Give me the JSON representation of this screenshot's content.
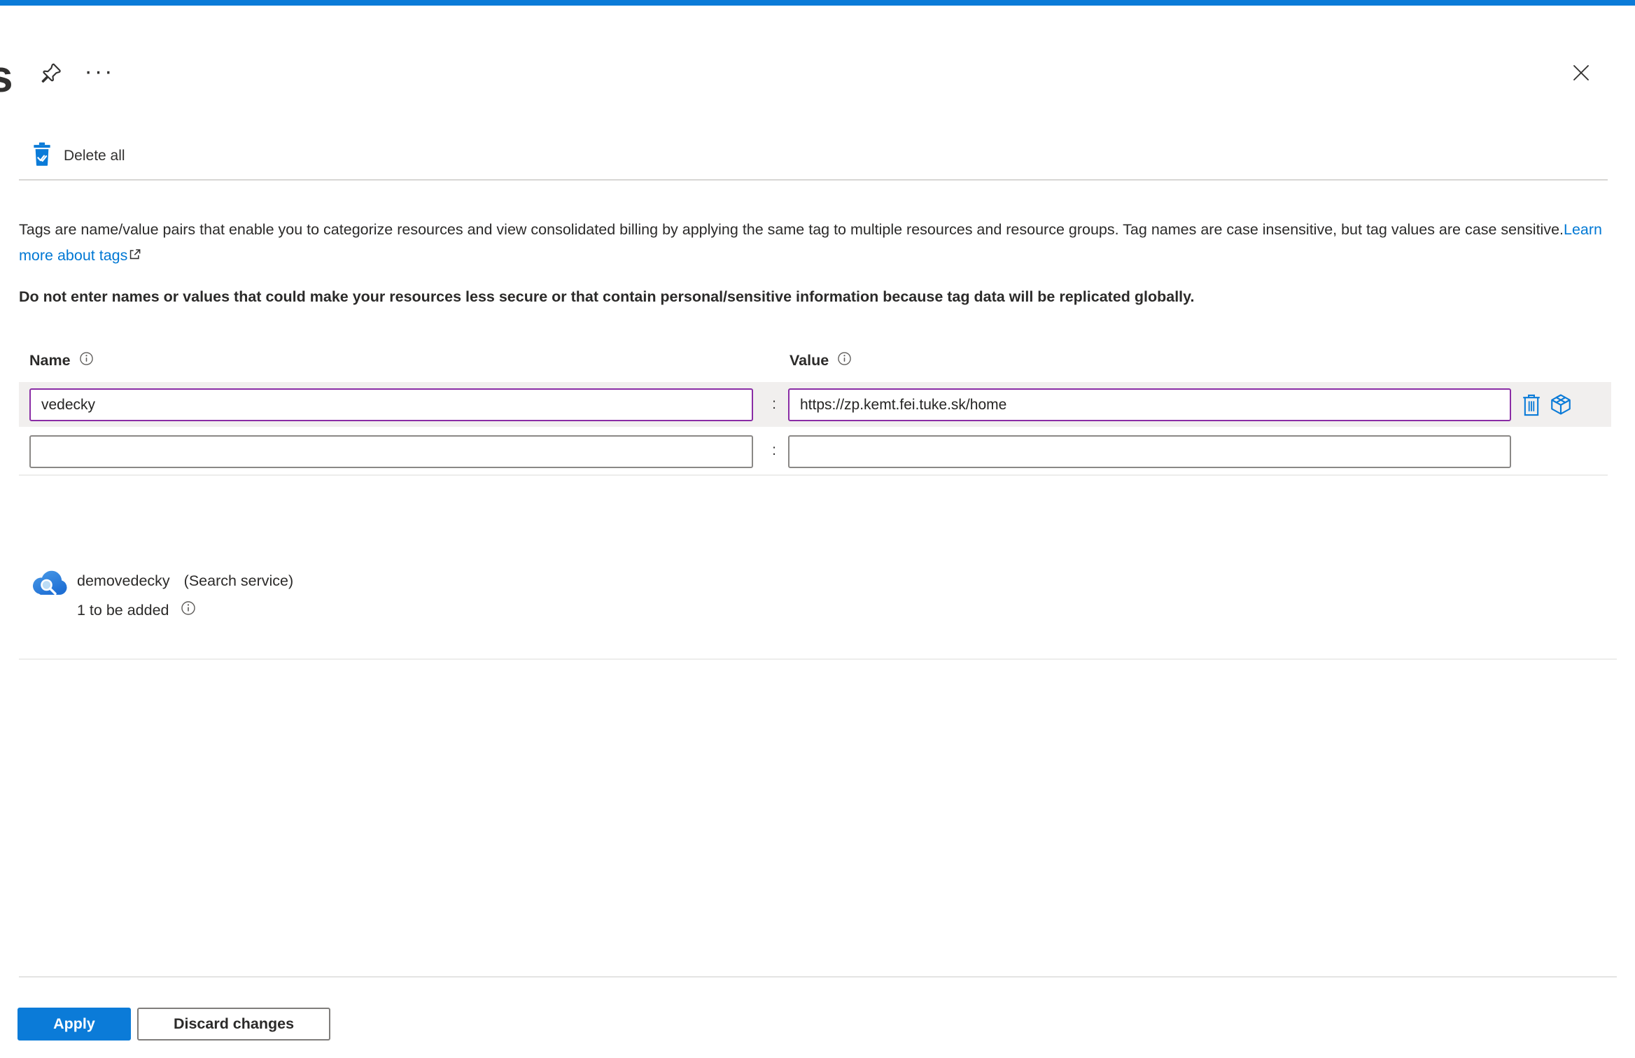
{
  "page": {
    "title_partial": "s"
  },
  "header": {
    "more_glyph": "···"
  },
  "toolbar": {
    "delete_all_label": "Delete all"
  },
  "description": {
    "text": "Tags are name/value pairs that enable you to categorize resources and view consolidated billing by applying the same tag to multiple resources and resource groups. Tag names are case insensitive, but tag values are case sensitive.",
    "link_label": "Learn more about tags",
    "warning": "Do not enter names or values that could make your resources less secure or that contain personal/sensitive information because tag data will be replicated globally."
  },
  "tag_editor": {
    "name_header": "Name",
    "value_header": "Value",
    "separator": ":",
    "rows": [
      {
        "name": "vedecky",
        "value": "https://zp.kemt.fei.tuke.sk/home"
      },
      {
        "name": "",
        "value": ""
      }
    ]
  },
  "resource": {
    "name": "demovedecky",
    "type": "(Search service)",
    "pending": "1 to be added"
  },
  "footer": {
    "apply_label": "Apply",
    "discard_label": "Discard changes"
  },
  "colors": {
    "accent_blue": "#0b7bd8",
    "link_blue": "#0078d4",
    "modified_purple": "#8a2da5",
    "row_highlight": "#f1efee"
  }
}
